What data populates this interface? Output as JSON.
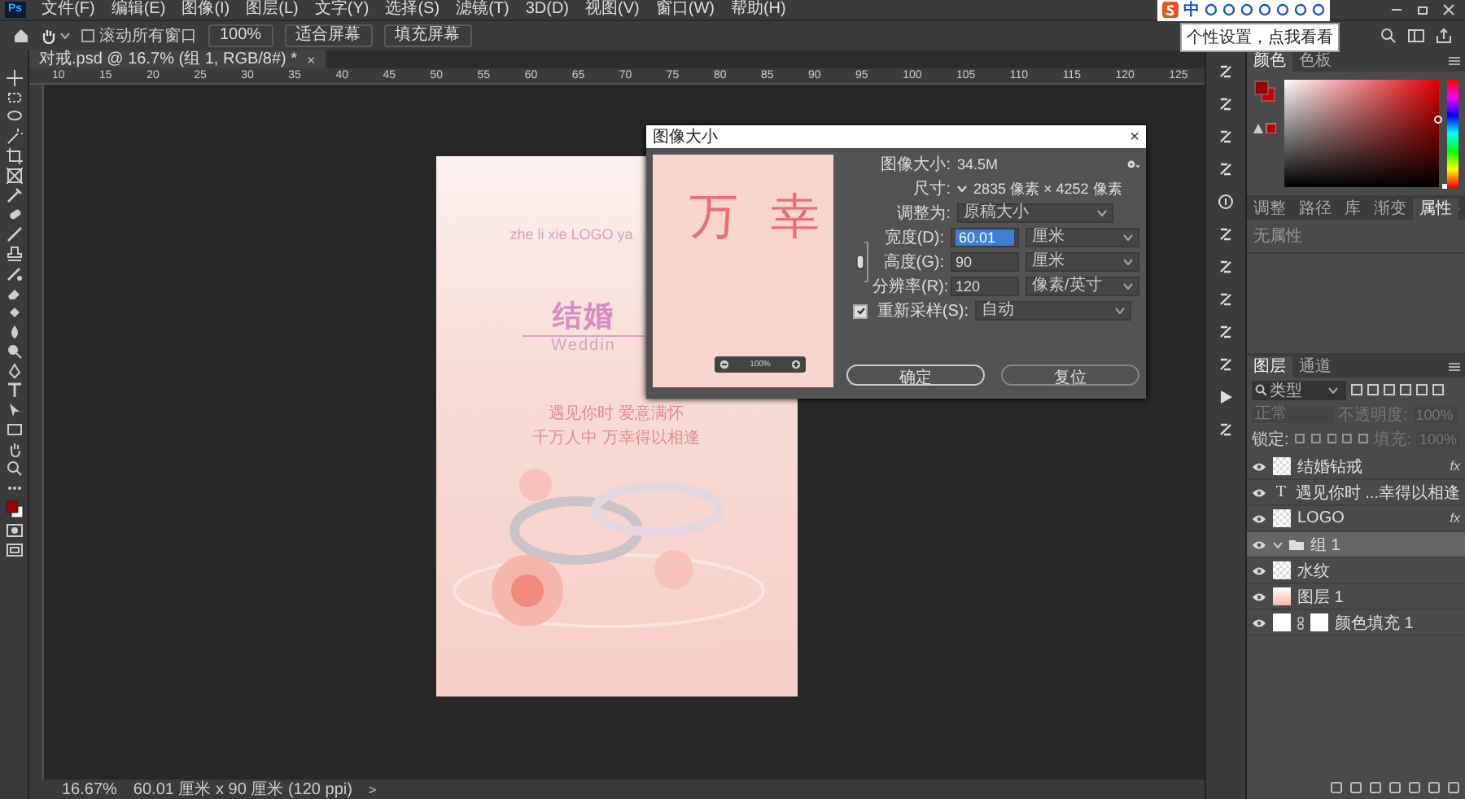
{
  "app": {
    "logo": "Ps",
    "menu": [
      "文件(F)",
      "编辑(E)",
      "图像(I)",
      "图层(L)",
      "文字(Y)",
      "选择(S)",
      "滤镜(T)",
      "3D(D)",
      "视图(V)",
      "窗口(W)",
      "帮助(H)"
    ]
  },
  "options_bar": {
    "scroll_all": {
      "label": "滚动所有窗口",
      "checked": false
    },
    "zoom": "100%",
    "buttons": [
      "适合屏幕",
      "填充屏幕"
    ]
  },
  "ime_bar": {
    "mode": "中",
    "tooltip": "个性设置，点我看看"
  },
  "document_tab": {
    "title": "对戒.psd @ 16.7% (组 1, RGB/8#) *",
    "close": "×"
  },
  "ruler_labels": [
    "10",
    "15",
    "20",
    "25",
    "30",
    "35",
    "40",
    "45",
    "50",
    "55",
    "60",
    "65",
    "70",
    "75",
    "80",
    "85",
    "90",
    "95",
    "100",
    "105",
    "110",
    "115",
    "120",
    "125"
  ],
  "poster": {
    "logo_text": "zhe li xie LOGO ya",
    "title": "结婚",
    "subtitle": "Weddin",
    "lines": [
      "遇见你时 爱意满怀",
      "千万人中 万幸得以相逢"
    ]
  },
  "dialog": {
    "title": "图像大小",
    "close": "×",
    "preview_text": "万 幸",
    "preview_zoom": "100%",
    "size_label": "图像大小:",
    "size_value": "34.5M",
    "dimensions_label": "尺寸:",
    "dimensions_value": "2835 像素 × 4252 像素",
    "fit_label": "调整为:",
    "fit_value": "原稿大小",
    "constrain_proportions": true,
    "fields": [
      {
        "label": "宽度(D):",
        "value": "60.01",
        "unit": "厘米",
        "selected": true
      },
      {
        "label": "高度(G):",
        "value": "90",
        "unit": "厘米",
        "selected": false
      },
      {
        "label": "分辨率(R):",
        "value": "120",
        "unit": "像素/英寸",
        "selected": false
      }
    ],
    "resample": {
      "label": "重新采样(S):",
      "checked": true,
      "value": "自动"
    },
    "buttons": [
      {
        "label": "确定",
        "default": true
      },
      {
        "label": "复位",
        "default": false
      }
    ]
  },
  "color_panel": {
    "tabs": [
      {
        "label": "颜色",
        "selected": true
      },
      {
        "label": "色板",
        "selected": false
      }
    ],
    "hue": {
      "level": 0
    }
  },
  "properties_panel": {
    "tabs": [
      {
        "label": "调整",
        "selected": false
      },
      {
        "label": "路径",
        "selected": false
      },
      {
        "label": "库",
        "selected": false
      },
      {
        "label": "渐变",
        "selected": false
      },
      {
        "label": "属性",
        "selected": true
      }
    ],
    "empty_text": "无属性"
  },
  "layers_panel": {
    "tabs": [
      {
        "label": "图层",
        "selected": true
      },
      {
        "label": "通道",
        "selected": false
      }
    ],
    "filter_placeholder": "类型",
    "blend_mode": {
      "value": "正常",
      "disabled": true
    },
    "opacity": {
      "label": "不透明度:",
      "value": "100%",
      "disabled": true
    },
    "lock_label": "锁定:",
    "fill": {
      "label": "填充:",
      "value": "100%",
      "disabled": true
    },
    "layers": [
      {
        "name": "结婚钻戒",
        "kind": "raster",
        "effects": "fx",
        "selected": false,
        "visible": true
      },
      {
        "name": "遇见你时 ...幸得以相逢",
        "kind": "text",
        "type_glyph": "T",
        "selected": false,
        "visible": true
      },
      {
        "name": "LOGO",
        "kind": "raster",
        "effects": "fx",
        "selected": false,
        "visible": true
      },
      {
        "name": "组 1",
        "kind": "group",
        "selected": true,
        "visible": true
      },
      {
        "name": "水纹",
        "kind": "raster",
        "selected": false,
        "visible": true
      },
      {
        "name": "图层 1",
        "kind": "gradient",
        "selected": false,
        "visible": true
      },
      {
        "name": "颜色填充 1",
        "kind": "fill",
        "selected": false,
        "visible": true
      }
    ]
  },
  "status_bar": {
    "zoom": "16.67%",
    "info": "60.01 厘米 x 90 厘米 (120 ppi)",
    "arrow": ">"
  }
}
